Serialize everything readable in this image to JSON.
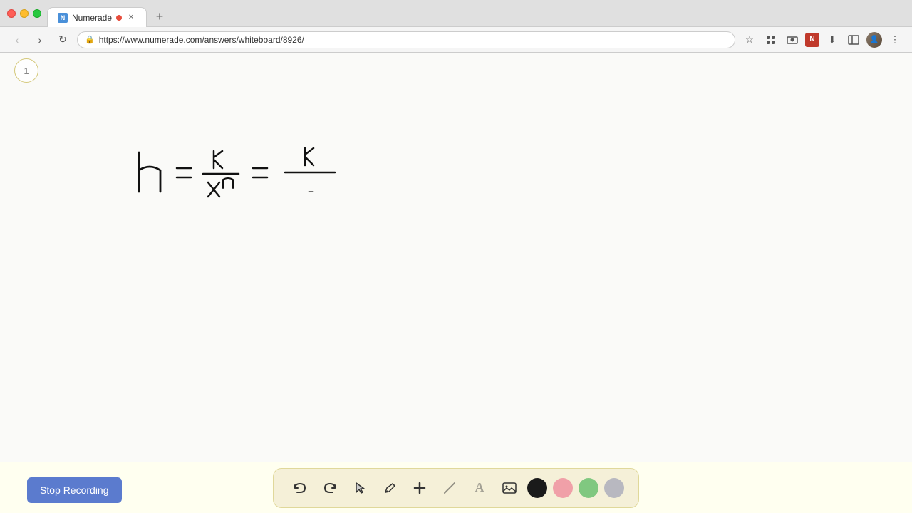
{
  "browser": {
    "tab_title": "Numerade",
    "tab_url_display": "https://www.numerade.com/answers/whiteboard/8926/",
    "new_tab_label": "+",
    "recording_dot_visible": true
  },
  "toolbar": {
    "back_label": "‹",
    "forward_label": "›",
    "refresh_label": "↻",
    "url": "https://www.numerade.com/answers/whiteboard/8926/"
  },
  "page": {
    "number": "1"
  },
  "bottom_toolbar": {
    "stop_recording_label": "Stop Recording",
    "undo_label": "↺",
    "redo_label": "↻",
    "select_label": "▲",
    "pen_label": "✏",
    "add_label": "+",
    "eraser_label": "/",
    "text_label": "A",
    "image_label": "🖼"
  },
  "colors": {
    "black": "#1a1a1a",
    "pink": "#f0a0a8",
    "green": "#80c880",
    "gray": "#b8b8c0",
    "stop_recording_bg": "#5b7bce",
    "toolbar_bg": "#f5f0d8",
    "page_bg": "#fafaf8",
    "accent_yellow": "#d4c87a"
  }
}
